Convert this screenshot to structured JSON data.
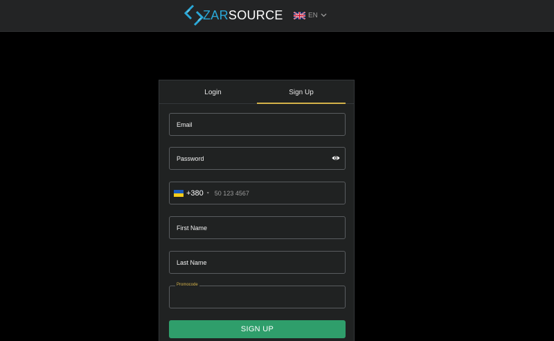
{
  "header": {
    "logo": {
      "text_highlight": "ZAR",
      "text_rest": "SOURCE",
      "icon": "zarsource-logo-icon"
    },
    "language": {
      "code": "EN",
      "flag_icon": "uk-flag-icon",
      "dropdown_icon": "chevron-down-icon"
    }
  },
  "tabs": [
    {
      "label": "Login",
      "active": false
    },
    {
      "label": "Sign Up",
      "active": true
    }
  ],
  "form": {
    "email": {
      "placeholder": "Email",
      "value": ""
    },
    "password": {
      "placeholder": "Password",
      "value": "",
      "toggle_icon": "eye-icon"
    },
    "phone": {
      "flag_icon": "ukraine-flag-icon",
      "country_code": "+380",
      "placeholder": "50 123 4567",
      "value": ""
    },
    "first_name": {
      "placeholder": "First Name",
      "value": ""
    },
    "last_name": {
      "placeholder": "Last Name",
      "value": ""
    },
    "promocode": {
      "label": "Promocode",
      "value": ""
    },
    "submit_label": "SIGN UP"
  },
  "colors": {
    "accent_gold": "#d4b24a",
    "brand_blue": "#2aa8d8",
    "submit_green": "#2f9e6b",
    "card_bg": "#202222",
    "header_bg": "#232425"
  }
}
